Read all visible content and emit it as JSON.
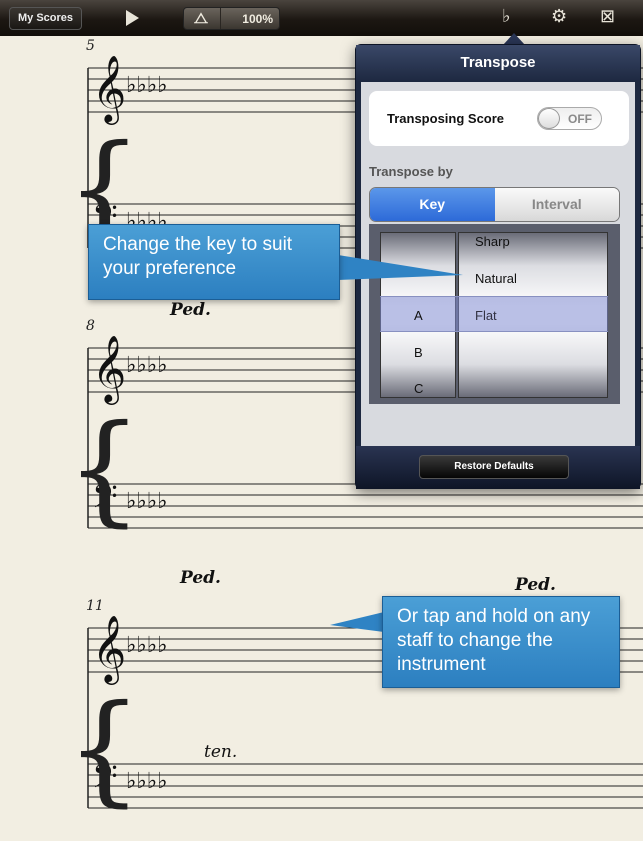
{
  "toolbar": {
    "my_scores": "My Scores",
    "play_icon": "play-icon",
    "metronome_icon": "metronome-icon",
    "zoom": "100%",
    "transpose_icon": "transpose-icon",
    "settings_icon": "gears-icon",
    "mixer_icon": "music-stand-icon"
  },
  "score": {
    "measure_numbers": [
      "5",
      "8",
      "11"
    ],
    "pedal": "Ped.",
    "tenuto": "ten."
  },
  "popover": {
    "title": "Transpose",
    "transposing_score_label": "Transposing Score",
    "toggle_state": "OFF",
    "transpose_by_label": "Transpose by",
    "segments": [
      "Key",
      "Interval"
    ],
    "selected_segment": "Key",
    "picker_col1": [
      "A",
      "B",
      "C"
    ],
    "picker_col2": [
      "Sharp",
      "Natural",
      "Flat"
    ],
    "selected": {
      "key": "A",
      "accidental": "Flat"
    },
    "restore_defaults": "Restore Defaults"
  },
  "callouts": {
    "key": "Change the key to suit your preference",
    "instrument": "Or tap and hold on any staff to change the instrument"
  },
  "colors": {
    "callout": "#3a8fcf",
    "segment_active": "#3b7ae0",
    "toolbar": "#1c1712"
  }
}
